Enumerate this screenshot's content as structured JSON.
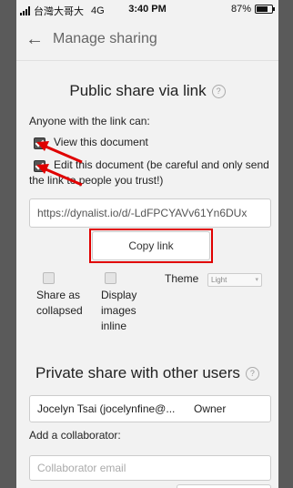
{
  "status_bar": {
    "carrier": "台灣大哥大",
    "network": "4G",
    "time": "3:40 PM",
    "battery": "87%",
    "battery_level": 0.87
  },
  "header": {
    "title": "Manage sharing"
  },
  "public_share": {
    "title": "Public share via link",
    "help": "?",
    "anyone_label": "Anyone with the link can:",
    "view_label": "View this document",
    "edit_label_line1": "Edit this document (be careful and only send",
    "edit_label_line2": "the link to people you trust!)",
    "link_url": "https://dynalist.io/d/-LdFPCYAVv61Yn6DUx",
    "copy_button": "Copy link"
  },
  "options": {
    "share_collapsed_line1": "Share as",
    "share_collapsed_line2": "collapsed",
    "display_images_line1": "Display",
    "display_images_line2": "images",
    "display_images_line3": "inline",
    "theme_label": "Theme",
    "theme_value": "Light"
  },
  "private_share": {
    "title": "Private share with other users",
    "help": "?",
    "user_name": "Jocelyn Tsai (jocelynfine@...",
    "user_role": "Owner",
    "add_label": "Add a collaborator:",
    "email_placeholder": "Collaborator email"
  },
  "colors": {
    "highlight": "#e00000",
    "background": "#f2f2f2"
  }
}
